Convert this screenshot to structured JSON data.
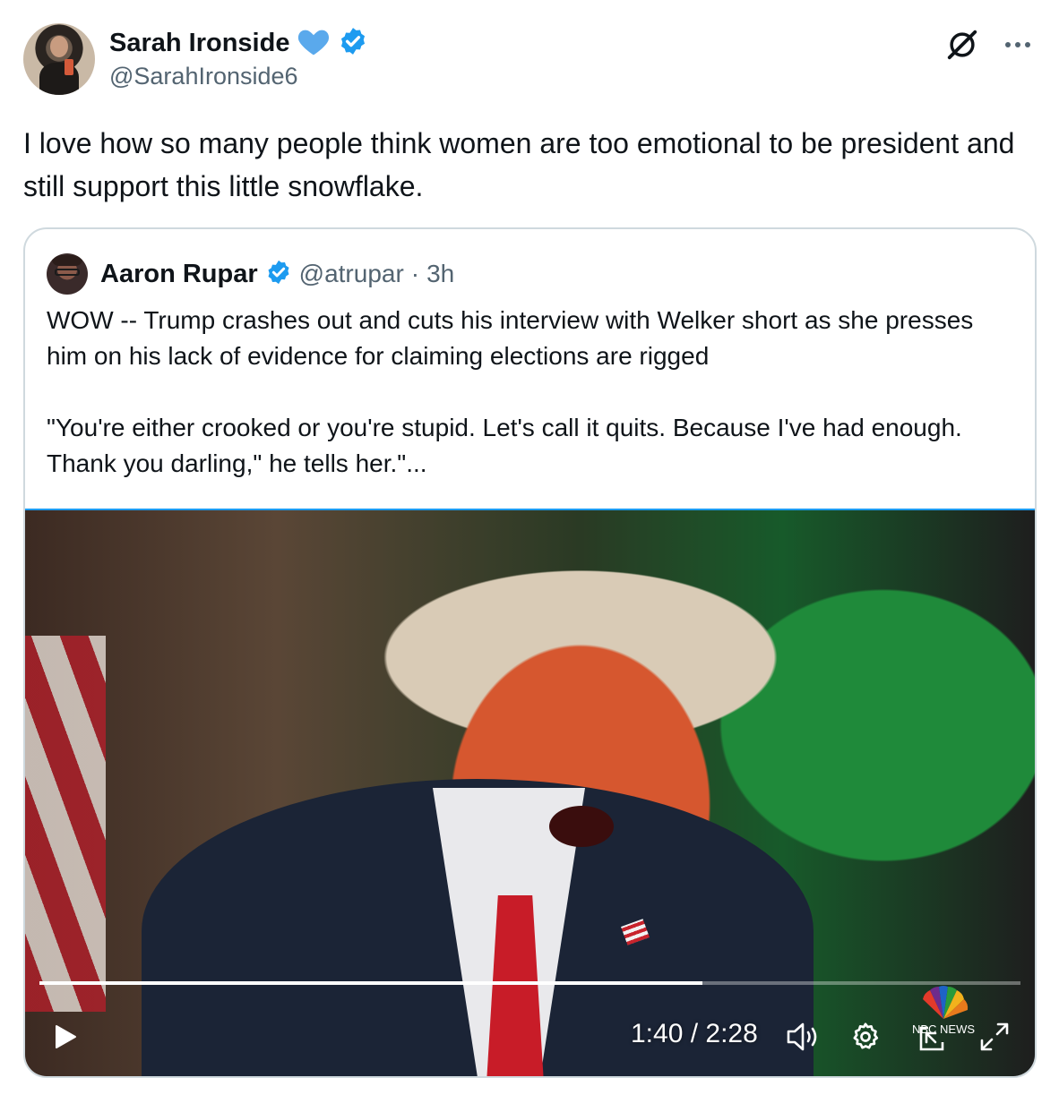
{
  "author": {
    "name": "Sarah Ironside",
    "handle": "@SarahIronside6"
  },
  "tweet": {
    "text": "I love how so many people think women are too emotional to be president and still support this little snowflake."
  },
  "quoted": {
    "name": "Aaron Rupar",
    "handle": "@atrupar",
    "separator": "·",
    "time": "3h",
    "text": "WOW -- Trump crashes out and cuts his interview with Welker short as she presses him on his lack of evidence for claiming elections are rigged\n\n\"You're either crooked or you're stupid. Let's call it quits. Because I've had enough. Thank you darling,\" he tells her.\"..."
  },
  "video": {
    "time_display": "1:40 / 2:28",
    "progress": 0.676,
    "watermark_text": "NBC NEWS"
  },
  "colors": {
    "verified_blue": "#1d9bf0",
    "heart_blue": "#5aa9ec",
    "secondary_text": "#536471",
    "border": "#cfd9de"
  },
  "icons": {
    "heart": "blue-heart-icon",
    "verified": "verified-badge-icon",
    "grok": "grok-icon",
    "more": "more-icon",
    "play": "play-icon",
    "volume": "volume-icon",
    "settings": "settings-gear-icon",
    "minimize": "pip-icon",
    "fullscreen": "fullscreen-icon"
  }
}
